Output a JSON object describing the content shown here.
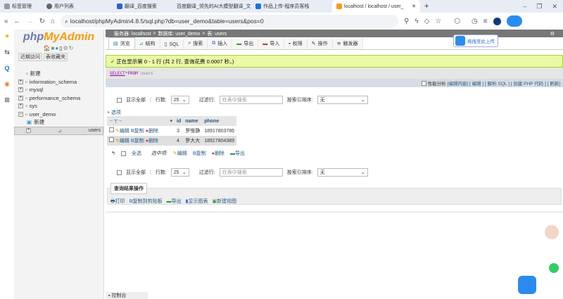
{
  "browser": {
    "tabs": [
      {
        "label": "标签管理",
        "color": "#999"
      },
      {
        "label": "用户列表",
        "color": "#666"
      },
      {
        "label": "翻译_百度搜索",
        "color": "#3060d0"
      },
      {
        "label": "百度翻译_领先的AI大模型翻译_文",
        "color": "#2a7be4"
      },
      {
        "label": "作品上传-程序员客栈",
        "color": "#1a73e8"
      },
      {
        "label": "localhost / localhost / user_",
        "color": "#f89c0e"
      }
    ],
    "new_tab": "+",
    "url": "localhost/phpMyAdmin4.8.5/sql.php?db=user_demo&table=users&pos=0"
  },
  "sidebar": {
    "logo_php": "php",
    "logo_ma": "MyAdmin",
    "recent": "近期访问",
    "favorites": "表收藏夹",
    "tree": [
      {
        "label": "新建"
      },
      {
        "label": "information_schema"
      },
      {
        "label": "mysql"
      },
      {
        "label": "performance_schema"
      },
      {
        "label": "sys"
      },
      {
        "label": "user_demo"
      },
      {
        "label": "新建"
      },
      {
        "label": "users"
      }
    ]
  },
  "breadcrumb": {
    "server": "服务器: localhost",
    "db": "数据库: user_demo",
    "table": "表: users"
  },
  "tabs": [
    "浏览",
    "结构",
    "SQL",
    "搜索",
    "插入",
    "导出",
    "导入",
    "权限",
    "操作",
    "触发器"
  ],
  "upload_label": "拖拽至此上传",
  "success": "正在显示第 0 - 1 行 (共 2 行, 查询花费 0.0007 秒。)",
  "sql": {
    "kw1": "SELECT",
    "mid": " * ",
    "kw2": "FROM",
    "tbl": " `users`"
  },
  "profiling": {
    "label": "性能分析",
    "links": "[编辑内嵌] [ 编辑 ] [ 解析 SQL ] [ 创建 PHP 代码 ] [ 刷新]"
  },
  "nav": {
    "show_all": "显示全部",
    "rows_label": "行数:",
    "rows_value": "25",
    "filter_label": "过滤行:",
    "filter_placeholder": "在表中搜索",
    "sort_label": "按索引排序:",
    "sort_value": "无"
  },
  "options": "+ 选项",
  "table": {
    "headers": [
      "id",
      "name",
      "phone"
    ],
    "rows": [
      {
        "id": "3",
        "name": "罗惟静",
        "phone": "18917803786"
      },
      {
        "id": "4",
        "name": "罗大大",
        "phone": "18917804389"
      }
    ],
    "edit": "编辑",
    "copy": "复制",
    "delete": "删除"
  },
  "bulk": {
    "select_all": "全选",
    "selected": "选中项:",
    "edit": "编辑",
    "copy": "复制",
    "delete": "删除",
    "export": "导出"
  },
  "qro": {
    "legend": "查询结果操作",
    "print": "打印",
    "clipboard": "复制到剪贴板",
    "export": "导出",
    "chart": "显示图表",
    "view": "新建视图"
  },
  "console": "控制台"
}
